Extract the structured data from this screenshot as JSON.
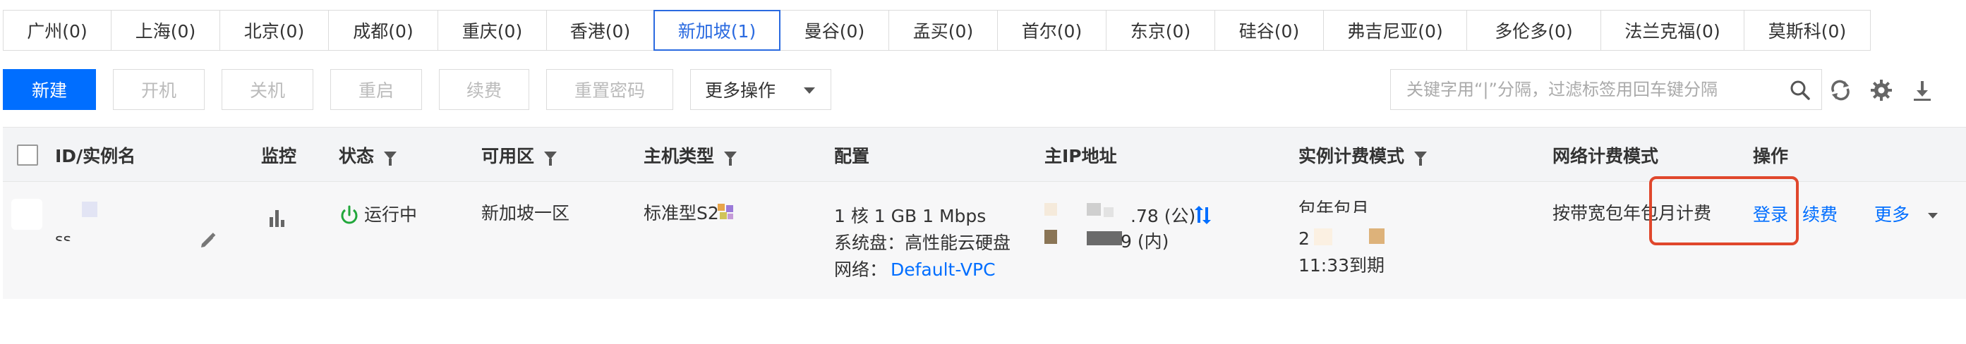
{
  "regions": [
    {
      "label": "广州(0)"
    },
    {
      "label": "上海(0)"
    },
    {
      "label": "北京(0)"
    },
    {
      "label": "成都(0)"
    },
    {
      "label": "重庆(0)"
    },
    {
      "label": "香港(0)"
    },
    {
      "label": "新加坡(1)",
      "active": true
    },
    {
      "label": "曼谷(0)"
    },
    {
      "label": "孟买(0)"
    },
    {
      "label": "首尔(0)"
    },
    {
      "label": "东京(0)"
    },
    {
      "label": "硅谷(0)"
    },
    {
      "label": "弗吉尼亚(0)"
    },
    {
      "label": "多伦多(0)"
    },
    {
      "label": "法兰克福(0)"
    },
    {
      "label": "莫斯科(0)"
    }
  ],
  "toolbar": {
    "new": "新建",
    "power_on": "开机",
    "power_off": "关机",
    "restart": "重启",
    "renew": "续费",
    "reset_password": "重置密码",
    "more_actions": "更多操作"
  },
  "search": {
    "placeholder": "关键字用“|”分隔，过滤标签用回车键分隔"
  },
  "columns": {
    "id": "ID/实例名",
    "monitor": "监控",
    "status": "状态",
    "zone": "可用区",
    "type": "主机类型",
    "config": "配置",
    "ip": "主IP地址",
    "billing": "实例计费模式",
    "net_billing": "网络计费模式",
    "ops": "操作"
  },
  "instance": {
    "name_fragment": "ss",
    "status": "运行中",
    "zone": "新加坡一区",
    "type": "标准型S2",
    "config_line1": "1 核 1 GB 1 Mbps",
    "config_line2": "系统盘：高性能云硬盘",
    "network_label": "网络：",
    "network_value": "Default-VPC",
    "ip_public": ".78 (公)",
    "ip_private": "9 (内)",
    "billing_line1": "包年包月",
    "billing_line2": "2",
    "billing_line3": "11:33到期",
    "net_billing": "按带宽包年包月计费",
    "op_login": "登录",
    "op_renew": "续费",
    "op_more": "更多"
  },
  "colors": {
    "primary": "#006eff",
    "running": "#21a73b",
    "highlight": "#e0472c"
  }
}
